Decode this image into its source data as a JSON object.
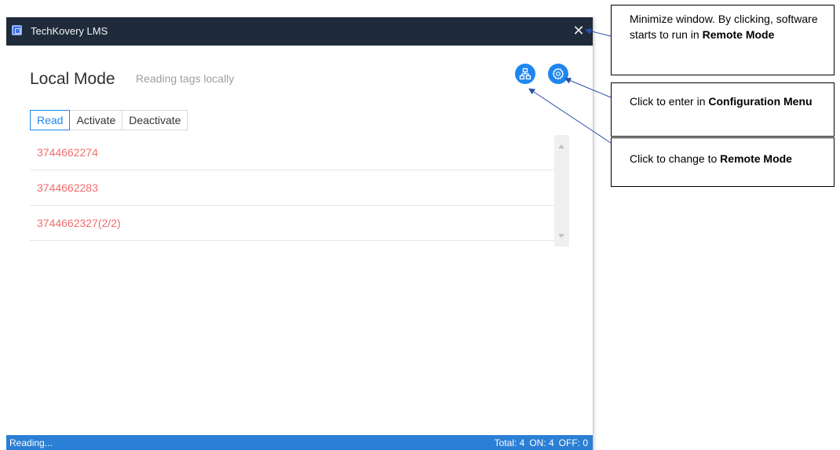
{
  "window": {
    "title": "TechKovery LMS",
    "close_symbol": "✕"
  },
  "header": {
    "mode_title": "Local Mode",
    "mode_subtitle": "Reading tags locally",
    "remote_button_icon": "network-icon",
    "config_button_icon": "gear-icon"
  },
  "tabs": [
    {
      "label": "Read",
      "active": true
    },
    {
      "label": "Activate",
      "active": false
    },
    {
      "label": "Deactivate",
      "active": false
    }
  ],
  "tags": [
    {
      "id": "3744662274"
    },
    {
      "id": "3744662283"
    },
    {
      "id": "3744662327(2/2)"
    }
  ],
  "status": {
    "left": "Reading...",
    "total": "Total: 4",
    "on": "ON: 4",
    "off": "OFF: 0"
  },
  "annotations": {
    "minimize": {
      "text": "Minimize window. By clicking, software starts to run in ",
      "bold": "Remote Mode"
    },
    "config": {
      "text": "Click to enter in ",
      "bold": "Configuration Menu"
    },
    "remote": {
      "text": "Click to change to ",
      "bold": "Remote Mode"
    }
  },
  "colors": {
    "titlebar": "#1f2a3a",
    "accent": "#1f86f0",
    "tag_text": "#f26d6d",
    "statusbar": "#2b7fd4"
  }
}
